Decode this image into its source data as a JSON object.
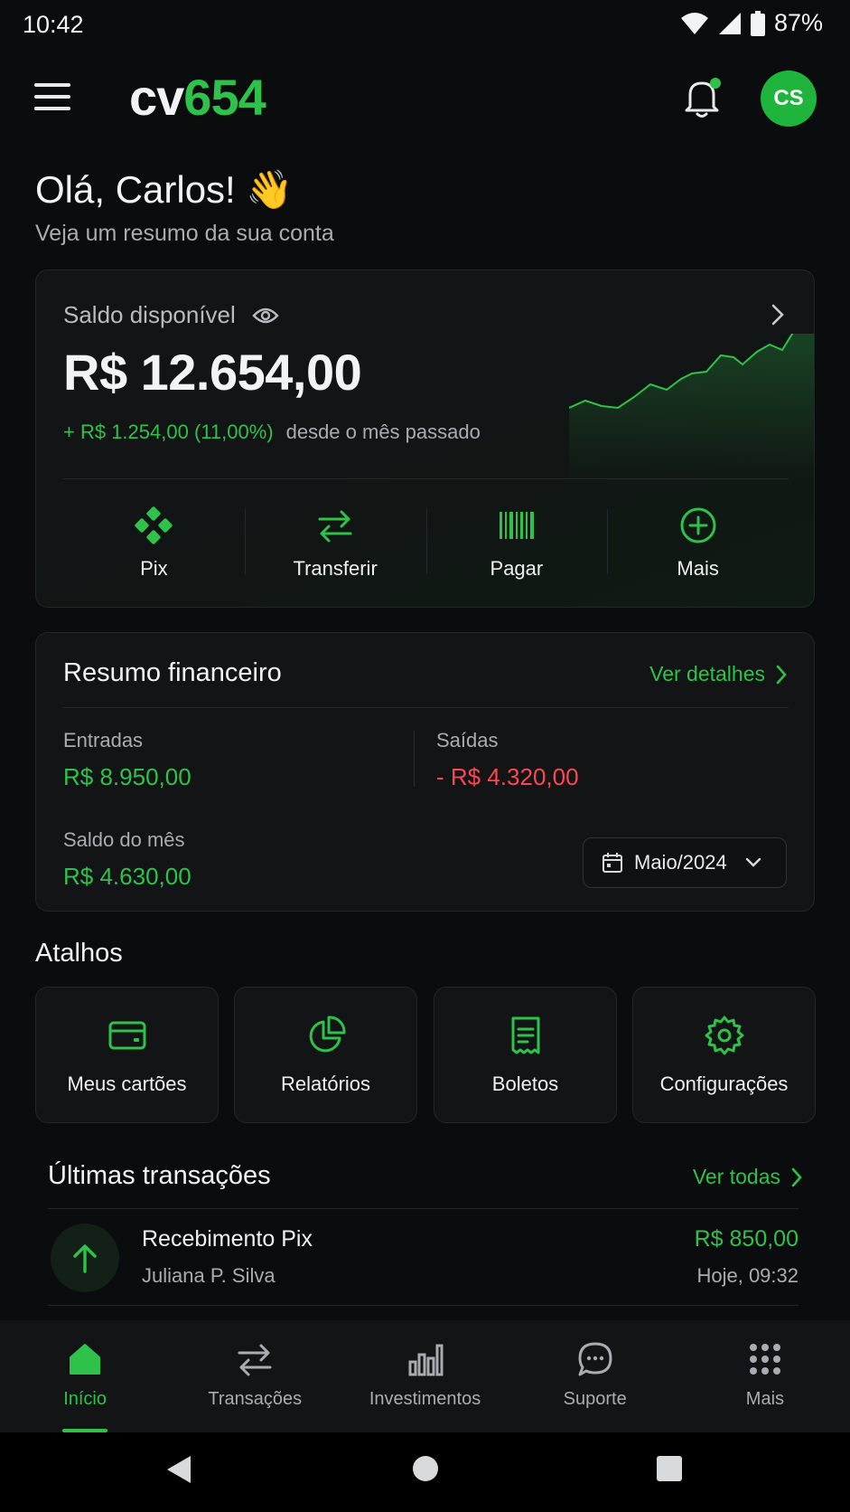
{
  "status": {
    "time": "10:42",
    "battery": "87%"
  },
  "header": {
    "logo_part1": "cv",
    "logo_part2": "654",
    "avatar_initials": "CS"
  },
  "greeting": {
    "title": "Olá, Carlos! 👋",
    "subtitle": "Veja um resumo da sua conta"
  },
  "balance": {
    "label": "Saldo disponível",
    "value": "R$ 12.654,00",
    "change": "+ R$ 1.254,00 (11,00%)",
    "since": "desde o mês passado",
    "actions": [
      {
        "label": "Pix",
        "icon": "pix-icon"
      },
      {
        "label": "Transferir",
        "icon": "transfer-icon"
      },
      {
        "label": "Pagar",
        "icon": "barcode-icon"
      },
      {
        "label": "Mais",
        "icon": "plus-circle-icon"
      }
    ]
  },
  "summary": {
    "title": "Resumo financeiro",
    "link": "Ver detalhes",
    "income_label": "Entradas",
    "income_value": "R$ 8.950,00",
    "expense_label": "Saídas",
    "expense_value": "- R$ 4.320,00",
    "month_balance_label": "Saldo do mês",
    "month_balance_value": "R$ 4.630,00",
    "month_select": "Maio/2024"
  },
  "shortcuts": {
    "title": "Atalhos",
    "items": [
      {
        "label": "Meus cartões",
        "icon": "card-icon"
      },
      {
        "label": "Relatórios",
        "icon": "pie-chart-icon"
      },
      {
        "label": "Boletos",
        "icon": "receipt-icon"
      },
      {
        "label": "Configurações",
        "icon": "gear-icon"
      }
    ]
  },
  "transactions": {
    "title": "Últimas transações",
    "link": "Ver todas",
    "items": [
      {
        "name": "Recebimento Pix",
        "from": "Juliana P. Silva",
        "amount": "R$ 850,00",
        "time": "Hoje, 09:32",
        "icon": "arrow-up-icon"
      }
    ]
  },
  "nav": {
    "items": [
      {
        "label": "Início",
        "icon": "home-icon",
        "active": true
      },
      {
        "label": "Transações",
        "icon": "transfer-icon"
      },
      {
        "label": "Investimentos",
        "icon": "bar-chart-icon"
      },
      {
        "label": "Suporte",
        "icon": "chat-icon"
      },
      {
        "label": "Mais",
        "icon": "grid-icon"
      }
    ]
  },
  "colors": {
    "accent": "#2ec24a",
    "negative": "#ff4550",
    "background": "#0b0c0d",
    "card": "#121416"
  }
}
